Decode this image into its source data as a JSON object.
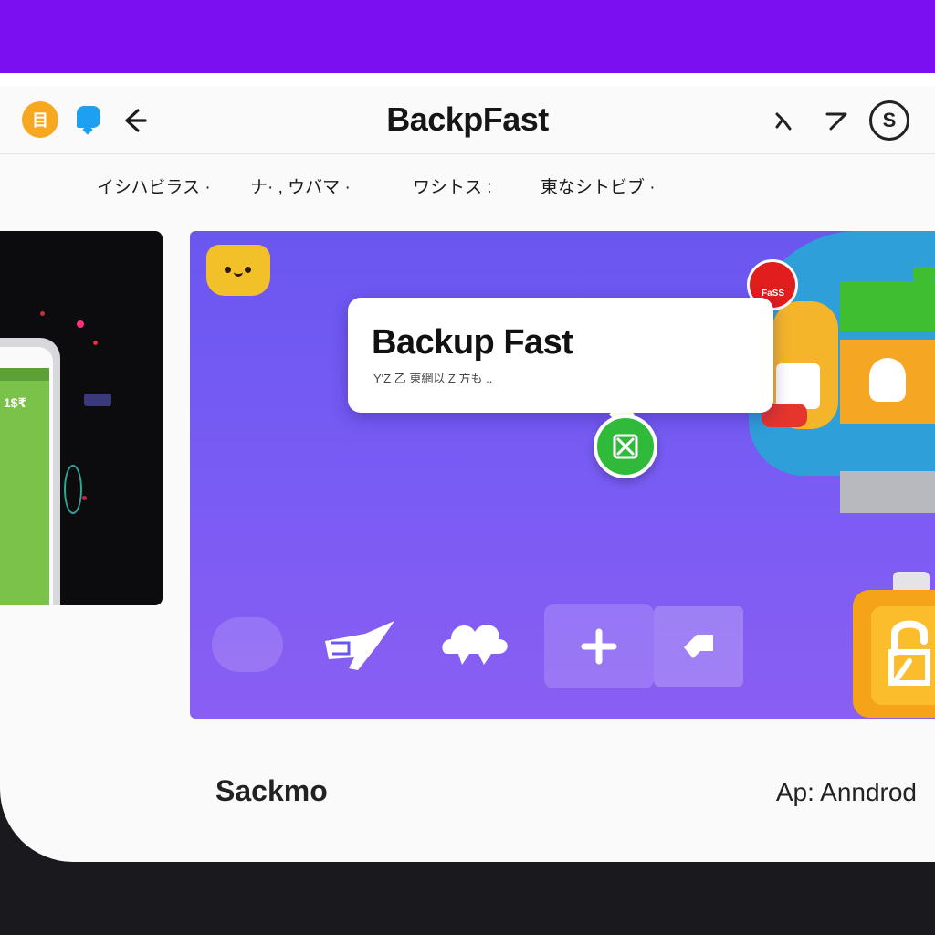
{
  "header": {
    "title": "BackpFast",
    "app_icon_label": "目",
    "right_icon_label": "S"
  },
  "menu": {
    "items": [
      {
        "label": "イシハビラス ·"
      },
      {
        "label": "ナ· , ウバマ ·"
      },
      {
        "label": "ワシトス :"
      },
      {
        "label": "東なシトビブ ·"
      }
    ]
  },
  "phone": {
    "screen_text": "1$₹"
  },
  "hero": {
    "callout_title": "Backup Fast",
    "callout_subtitle": "Y'Z 乙 東網以 Z 方も ..",
    "badge_text": "FaSS"
  },
  "footer": {
    "left": "Sackmo",
    "right": "Ap: Anndrod"
  },
  "colors": {
    "top_bar": "#7b0ff0",
    "hero_gradient": "#6a57f0",
    "accent_green": "#2fba3a",
    "accent_orange": "#f5a623"
  }
}
